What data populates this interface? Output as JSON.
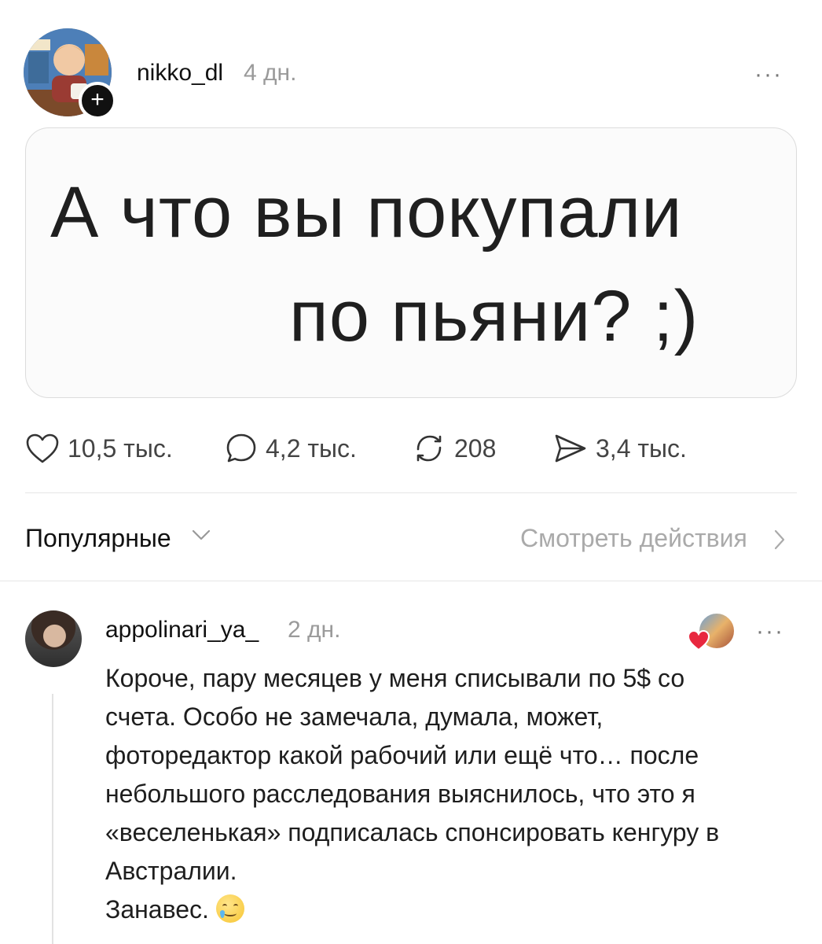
{
  "post": {
    "username": "nikko_dl",
    "time": "4 дн.",
    "follow_label": "+",
    "more_label": "···",
    "card_line1": "А что вы покупали",
    "card_line2": "по пьяни? ;)"
  },
  "actions": {
    "likes": "10,5 тыс.",
    "comments": "4,2 тыс.",
    "reposts": "208",
    "shares": "3,4 тыс."
  },
  "sort": {
    "label": "Популярные",
    "view_actions": "Смотреть действия"
  },
  "comment": {
    "username": "appolinari_ya_",
    "time": "2 дн.",
    "more_label": "···",
    "text": "Короче, пару месяцев у меня списывали по 5$ со\nсчета. Особо не замечала, думала, может,\nфоторедактор какой рабочий или ещё что… после\nнебольшого расследования выяснилось, что это я\n«веселенькая» подписалась спонсировать кенгуру в\nАвстралии.\nЗанавес.",
    "emoji": "smiling-face-with-tear"
  }
}
